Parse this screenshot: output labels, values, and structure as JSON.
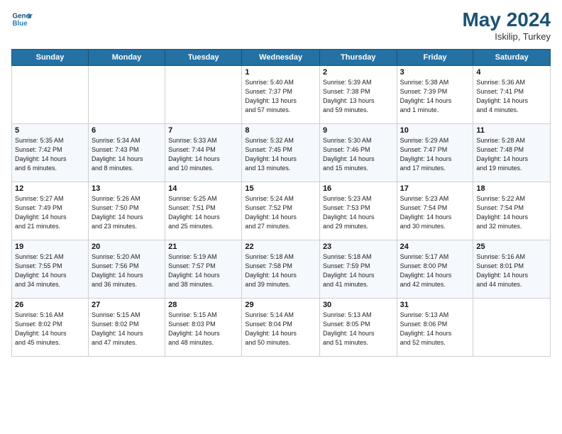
{
  "header": {
    "logo_line1": "General",
    "logo_line2": "Blue",
    "month_year": "May 2024",
    "location": "Iskilip, Turkey"
  },
  "days_of_week": [
    "Sunday",
    "Monday",
    "Tuesday",
    "Wednesday",
    "Thursday",
    "Friday",
    "Saturday"
  ],
  "weeks": [
    [
      {
        "day": "",
        "info": ""
      },
      {
        "day": "",
        "info": ""
      },
      {
        "day": "",
        "info": ""
      },
      {
        "day": "1",
        "info": "Sunrise: 5:40 AM\nSunset: 7:37 PM\nDaylight: 13 hours\nand 57 minutes."
      },
      {
        "day": "2",
        "info": "Sunrise: 5:39 AM\nSunset: 7:38 PM\nDaylight: 13 hours\nand 59 minutes."
      },
      {
        "day": "3",
        "info": "Sunrise: 5:38 AM\nSunset: 7:39 PM\nDaylight: 14 hours\nand 1 minute."
      },
      {
        "day": "4",
        "info": "Sunrise: 5:36 AM\nSunset: 7:41 PM\nDaylight: 14 hours\nand 4 minutes."
      }
    ],
    [
      {
        "day": "5",
        "info": "Sunrise: 5:35 AM\nSunset: 7:42 PM\nDaylight: 14 hours\nand 6 minutes."
      },
      {
        "day": "6",
        "info": "Sunrise: 5:34 AM\nSunset: 7:43 PM\nDaylight: 14 hours\nand 8 minutes."
      },
      {
        "day": "7",
        "info": "Sunrise: 5:33 AM\nSunset: 7:44 PM\nDaylight: 14 hours\nand 10 minutes."
      },
      {
        "day": "8",
        "info": "Sunrise: 5:32 AM\nSunset: 7:45 PM\nDaylight: 14 hours\nand 13 minutes."
      },
      {
        "day": "9",
        "info": "Sunrise: 5:30 AM\nSunset: 7:46 PM\nDaylight: 14 hours\nand 15 minutes."
      },
      {
        "day": "10",
        "info": "Sunrise: 5:29 AM\nSunset: 7:47 PM\nDaylight: 14 hours\nand 17 minutes."
      },
      {
        "day": "11",
        "info": "Sunrise: 5:28 AM\nSunset: 7:48 PM\nDaylight: 14 hours\nand 19 minutes."
      }
    ],
    [
      {
        "day": "12",
        "info": "Sunrise: 5:27 AM\nSunset: 7:49 PM\nDaylight: 14 hours\nand 21 minutes."
      },
      {
        "day": "13",
        "info": "Sunrise: 5:26 AM\nSunset: 7:50 PM\nDaylight: 14 hours\nand 23 minutes."
      },
      {
        "day": "14",
        "info": "Sunrise: 5:25 AM\nSunset: 7:51 PM\nDaylight: 14 hours\nand 25 minutes."
      },
      {
        "day": "15",
        "info": "Sunrise: 5:24 AM\nSunset: 7:52 PM\nDaylight: 14 hours\nand 27 minutes."
      },
      {
        "day": "16",
        "info": "Sunrise: 5:23 AM\nSunset: 7:53 PM\nDaylight: 14 hours\nand 29 minutes."
      },
      {
        "day": "17",
        "info": "Sunrise: 5:23 AM\nSunset: 7:54 PM\nDaylight: 14 hours\nand 30 minutes."
      },
      {
        "day": "18",
        "info": "Sunrise: 5:22 AM\nSunset: 7:54 PM\nDaylight: 14 hours\nand 32 minutes."
      }
    ],
    [
      {
        "day": "19",
        "info": "Sunrise: 5:21 AM\nSunset: 7:55 PM\nDaylight: 14 hours\nand 34 minutes."
      },
      {
        "day": "20",
        "info": "Sunrise: 5:20 AM\nSunset: 7:56 PM\nDaylight: 14 hours\nand 36 minutes."
      },
      {
        "day": "21",
        "info": "Sunrise: 5:19 AM\nSunset: 7:57 PM\nDaylight: 14 hours\nand 38 minutes."
      },
      {
        "day": "22",
        "info": "Sunrise: 5:18 AM\nSunset: 7:58 PM\nDaylight: 14 hours\nand 39 minutes."
      },
      {
        "day": "23",
        "info": "Sunrise: 5:18 AM\nSunset: 7:59 PM\nDaylight: 14 hours\nand 41 minutes."
      },
      {
        "day": "24",
        "info": "Sunrise: 5:17 AM\nSunset: 8:00 PM\nDaylight: 14 hours\nand 42 minutes."
      },
      {
        "day": "25",
        "info": "Sunrise: 5:16 AM\nSunset: 8:01 PM\nDaylight: 14 hours\nand 44 minutes."
      }
    ],
    [
      {
        "day": "26",
        "info": "Sunrise: 5:16 AM\nSunset: 8:02 PM\nDaylight: 14 hours\nand 45 minutes."
      },
      {
        "day": "27",
        "info": "Sunrise: 5:15 AM\nSunset: 8:02 PM\nDaylight: 14 hours\nand 47 minutes."
      },
      {
        "day": "28",
        "info": "Sunrise: 5:15 AM\nSunset: 8:03 PM\nDaylight: 14 hours\nand 48 minutes."
      },
      {
        "day": "29",
        "info": "Sunrise: 5:14 AM\nSunset: 8:04 PM\nDaylight: 14 hours\nand 50 minutes."
      },
      {
        "day": "30",
        "info": "Sunrise: 5:13 AM\nSunset: 8:05 PM\nDaylight: 14 hours\nand 51 minutes."
      },
      {
        "day": "31",
        "info": "Sunrise: 5:13 AM\nSunset: 8:06 PM\nDaylight: 14 hours\nand 52 minutes."
      },
      {
        "day": "",
        "info": ""
      }
    ]
  ]
}
